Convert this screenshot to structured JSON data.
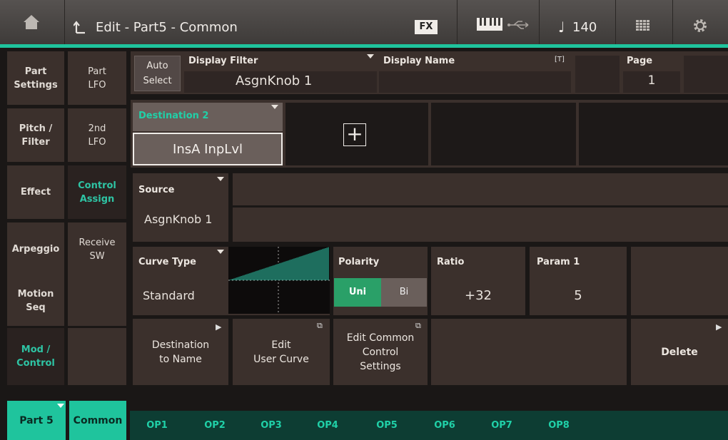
{
  "topbar": {
    "title": "Edit - Part5 - Common",
    "fx_label": "FX",
    "tempo": "140"
  },
  "sidebar": {
    "left": [
      {
        "label": "Part\nSettings"
      },
      {
        "label": "Pitch /\nFilter"
      },
      {
        "label": "Effect"
      },
      {
        "label": "Arpeggio"
      },
      {
        "label": "Motion\nSeq"
      },
      {
        "label": "Mod /\nControl"
      }
    ],
    "right": [
      {
        "label": "Part\nLFO"
      },
      {
        "label": "2nd\nLFO"
      },
      {
        "label": "Control\nAssign"
      },
      {
        "label": "Receive\nSW"
      }
    ]
  },
  "header": {
    "auto_select": "Auto\nSelect",
    "display_filter_label": "Display Filter",
    "display_filter_value": "AsgnKnob 1",
    "display_name_label": "Display Name",
    "text_icon": "[T]",
    "page_label": "Page",
    "page_value": "1"
  },
  "destination": {
    "label": "Destination 2",
    "value": "InsA InpLvl",
    "add_symbol": "+"
  },
  "source": {
    "label": "Source",
    "value": "AsgnKnob 1"
  },
  "curve": {
    "label": "Curve Type",
    "value": "Standard",
    "ratio_fraction": 0.6
  },
  "polarity": {
    "label": "Polarity",
    "uni": "Uni",
    "bi": "Bi",
    "selected": "Uni"
  },
  "ratio": {
    "label": "Ratio",
    "value": "+32"
  },
  "param1": {
    "label": "Param 1",
    "value": "5"
  },
  "actions": {
    "dest_to_name": "Destination\nto Name",
    "edit_user_curve": "Edit\nUser Curve",
    "edit_common": "Edit Common\nControl\nSettings",
    "delete": "Delete"
  },
  "bottom_tabs": {
    "part": "Part 5",
    "common": "Common",
    "ops": [
      "OP1",
      "OP2",
      "OP3",
      "OP4",
      "OP5",
      "OP6",
      "OP7",
      "OP8"
    ]
  },
  "colors": {
    "accent": "#1fc49d",
    "panel": "#3b302c",
    "active_green": "#2aa068"
  }
}
